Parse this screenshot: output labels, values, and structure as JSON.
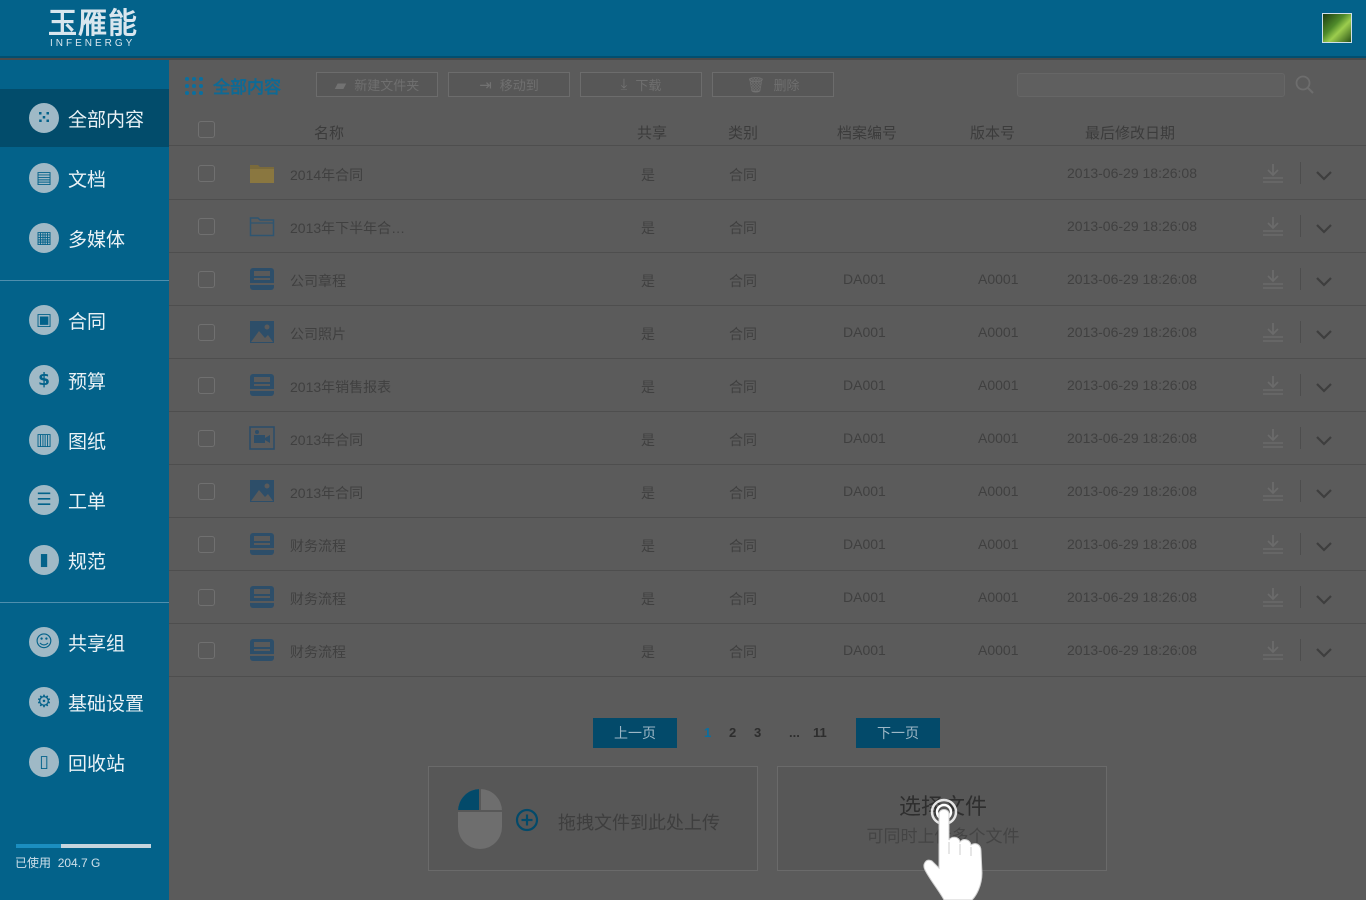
{
  "brand": {
    "logo_main": "玉雁能",
    "logo_sub": "INFENERGY"
  },
  "sidebar": {
    "items": [
      {
        "label": "全部内容",
        "icon": "grid-icon",
        "active": true
      },
      {
        "label": "文档",
        "icon": "document-icon"
      },
      {
        "label": "多媒体",
        "icon": "image-icon"
      },
      {
        "label": "合同",
        "icon": "contract-icon"
      },
      {
        "label": "预算",
        "icon": "dollar-icon"
      },
      {
        "label": "图纸",
        "icon": "map-icon"
      },
      {
        "label": "工单",
        "icon": "clipboard-icon"
      },
      {
        "label": "规范",
        "icon": "book-icon"
      },
      {
        "label": "共享组",
        "icon": "user-group-icon"
      },
      {
        "label": "基础设置",
        "icon": "gear-icon"
      },
      {
        "label": "回收站",
        "icon": "trash-icon"
      }
    ],
    "storage": {
      "label": "已使用",
      "value": "204.7 G",
      "used_fraction": 0.33
    }
  },
  "toolbar": {
    "breadcrumb": "全部内容",
    "new_folder": "新建文件夹",
    "move_to": "移动到",
    "download": "下载",
    "delete": "删除",
    "search_placeholder": ""
  },
  "table": {
    "headers": {
      "name": "名称",
      "share": "共享",
      "category": "类别",
      "archive_no": "档案编号",
      "version": "版本号",
      "modified": "最后修改日期"
    },
    "rows": [
      {
        "type": "folder-filled",
        "name": "2014年合同",
        "share": "是",
        "category": "合同",
        "archive_no": "",
        "version": "",
        "modified": "2013-06-29 18:26:08"
      },
      {
        "type": "folder-outline",
        "name": "2013年下半年合…",
        "share": "是",
        "category": "合同",
        "archive_no": "",
        "version": "",
        "modified": "2013-06-29 18:26:08"
      },
      {
        "type": "doc",
        "name": "公司章程",
        "share": "是",
        "category": "合同",
        "archive_no": "DA001",
        "version": "A0001",
        "modified": "2013-06-29 18:26:08"
      },
      {
        "type": "image",
        "name": "公司照片",
        "share": "是",
        "category": "合同",
        "archive_no": "DA001",
        "version": "A0001",
        "modified": "2013-06-29 18:26:08"
      },
      {
        "type": "doc",
        "name": "2013年销售报表",
        "share": "是",
        "category": "合同",
        "archive_no": "DA001",
        "version": "A0001",
        "modified": "2013-06-29 18:26:08"
      },
      {
        "type": "video",
        "name": "2013年合同",
        "share": "是",
        "category": "合同",
        "archive_no": "DA001",
        "version": "A0001",
        "modified": "2013-06-29 18:26:08"
      },
      {
        "type": "image",
        "name": "2013年合同",
        "share": "是",
        "category": "合同",
        "archive_no": "DA001",
        "version": "A0001",
        "modified": "2013-06-29 18:26:08"
      },
      {
        "type": "doc",
        "name": "财务流程",
        "share": "是",
        "category": "合同",
        "archive_no": "DA001",
        "version": "A0001",
        "modified": "2013-06-29 18:26:08"
      },
      {
        "type": "doc",
        "name": "财务流程",
        "share": "是",
        "category": "合同",
        "archive_no": "DA001",
        "version": "A0001",
        "modified": "2013-06-29 18:26:08"
      },
      {
        "type": "doc",
        "name": "财务流程",
        "share": "是",
        "category": "合同",
        "archive_no": "DA001",
        "version": "A0001",
        "modified": "2013-06-29 18:26:08"
      }
    ]
  },
  "pager": {
    "prev": "上一页",
    "next": "下一页",
    "pages": [
      "1",
      "2",
      "3"
    ],
    "ellipsis": "...",
    "last": "11",
    "current": "1"
  },
  "upload": {
    "drop_text": "拖拽文件到此处上传",
    "choose_title": "选择文件",
    "choose_sub": "可同时上传多个文件"
  }
}
